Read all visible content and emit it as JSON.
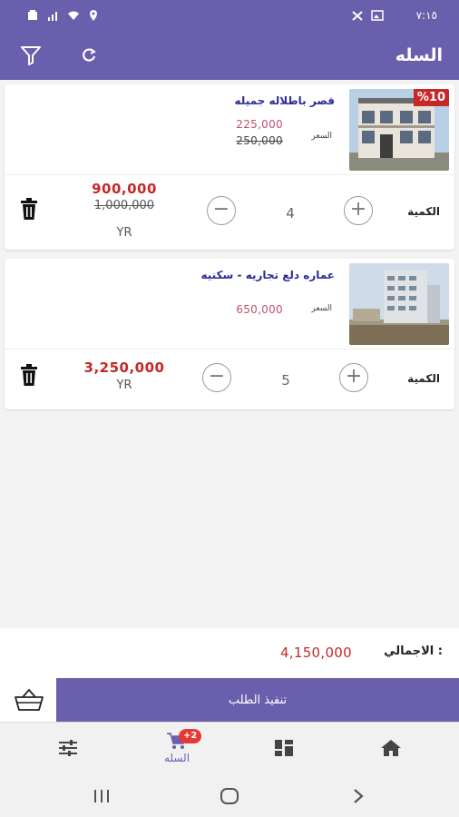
{
  "status_bar": {
    "time": "٧:١٥"
  },
  "app_bar": {
    "title": "السله"
  },
  "colors": {
    "primary": "#6a5fad",
    "price_red": "#c62828",
    "price_pink": "#c2516b",
    "title_blue": "#2c2c9e"
  },
  "cart_items": [
    {
      "name": "قصر باطلاله جميله",
      "discount": "%10",
      "price_label": "السعر",
      "price": "225,000",
      "old_price": "250,000",
      "qty_label": "الكمية",
      "qty": "4",
      "total": "900,000",
      "old_total": "1,000,000",
      "currency": "YR"
    },
    {
      "name": "عماره دلع تجاريه - سكنيه",
      "price_label": "السعر",
      "price": "650,000",
      "qty_label": "الكمية",
      "qty": "5",
      "total": "3,250,000",
      "currency": "YR"
    }
  ],
  "totals": {
    "label": "الاجمالي :",
    "value": "4,150,000"
  },
  "checkout": {
    "label": "تنفيذ الطلب"
  },
  "bottom_nav": {
    "cart_label": "السله",
    "cart_badge": "+2"
  },
  "icons": [
    "filter-icon",
    "refresh-icon",
    "trash-icon",
    "plus-icon",
    "minus-icon",
    "basket-icon",
    "home-icon",
    "grid-icon",
    "cart-icon",
    "sliders-icon"
  ]
}
